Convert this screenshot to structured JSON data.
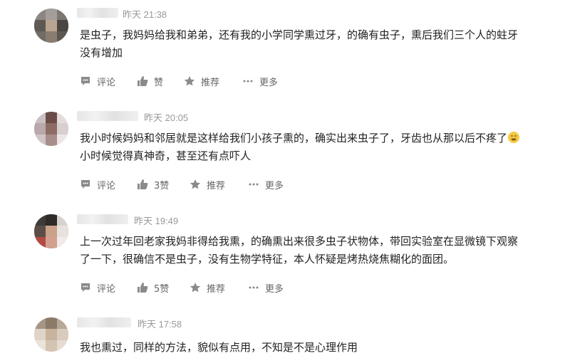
{
  "comments": [
    {
      "time": "昨天 21:38",
      "lines": [
        "是虫子，我妈妈给我和弟弟，还有我的小学同学熏过牙，的确有虫子，熏后我们三个人的蛀牙",
        "没有增加"
      ],
      "actions": {
        "comment": "评论",
        "like": "赞",
        "recommend": "推荐",
        "more": "更多"
      }
    },
    {
      "time": "昨天 20:05",
      "lines": [
        "我小时候妈妈和邻居就是这样给我们小孩子熏的，确实出来虫子了，牙齿也从那以后不疼了",
        "小时候觉得真神奇，甚至还有点吓人"
      ],
      "actions": {
        "comment": "评论",
        "like": "3赞",
        "recommend": "推荐",
        "more": "更多"
      }
    },
    {
      "time": "昨天 19:49",
      "lines": [
        "上一次过年回老家我妈非得给我熏，的确熏出来很多虫子状物体，带回实验室在显微镜下观察",
        "了一下，很确信不是虫子，没有生物学特征，本人怀疑是烤热烧焦糊化的面团。"
      ],
      "actions": {
        "comment": "评论",
        "like": "5赞",
        "recommend": "推荐",
        "more": "更多"
      }
    },
    {
      "time": "昨天 17:58",
      "lines": [
        "我也熏过，同样的方法，貌似有点用，不知是不是心理作用"
      ]
    }
  ],
  "icons": {
    "comment": "comment-icon",
    "like": "thumbs-up-icon",
    "recommend": "star-icon",
    "more": "more-dots-icon",
    "emoji": "grinning-emoji-icon"
  },
  "colors": {
    "text": "#222222",
    "meta": "#999999",
    "action": "#666666",
    "icon": "#8a8a8a",
    "emoji": "#f5c842"
  }
}
